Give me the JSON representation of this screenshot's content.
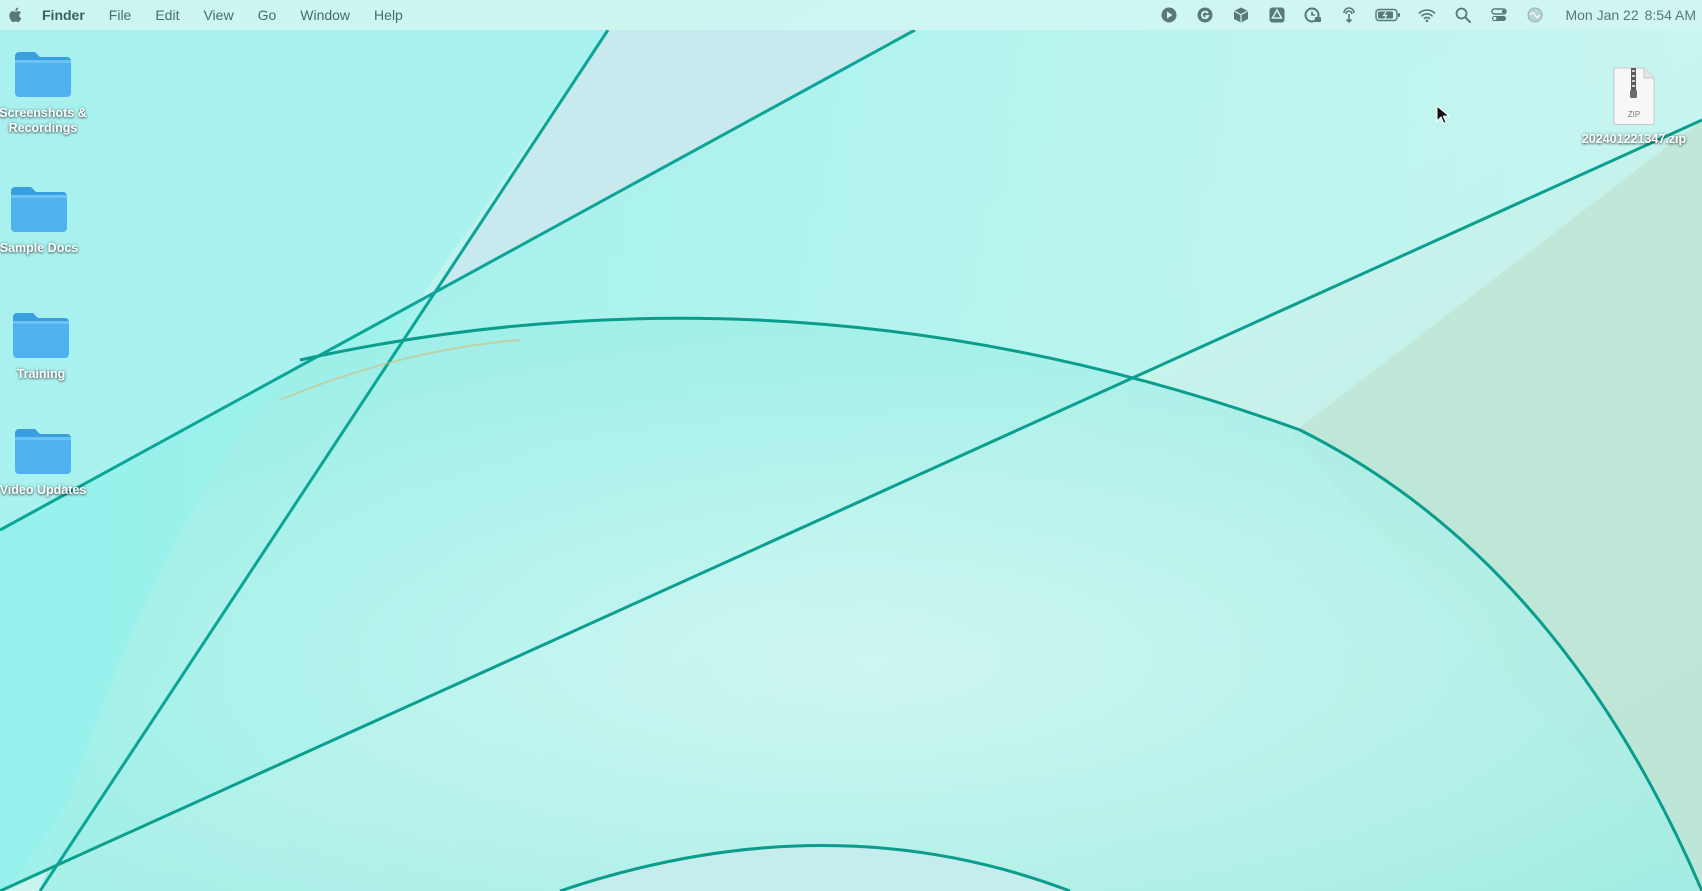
{
  "menubar": {
    "app_name": "Finder",
    "menus": [
      "File",
      "Edit",
      "View",
      "Go",
      "Window",
      "Help"
    ],
    "status_icons": [
      "play-circle-icon",
      "grammarly-icon",
      "package-box-icon",
      "google-drive-icon",
      "timer-lock-icon",
      "airdrop-icon",
      "battery-icon",
      "wifi-icon",
      "spotlight-search-icon",
      "control-center-icon",
      "siri-icon"
    ],
    "clock": {
      "date": "Mon Jan 22",
      "time": "8:54 AM"
    }
  },
  "desktop": {
    "left_icons": [
      {
        "label": "Screenshots & Recordings",
        "kind": "folder-icon"
      },
      {
        "label": "Sample Docs",
        "kind": "folder-icon"
      },
      {
        "label": "Training",
        "kind": "folder-icon"
      },
      {
        "label": "Video Updates",
        "kind": "folder-icon"
      }
    ],
    "right_icons": [
      {
        "label": "202401221347.zip",
        "kind": "zip-file-icon",
        "badge": "ZIP"
      }
    ]
  },
  "colors": {
    "wallpaper_base": "#bff0ec",
    "wallpaper_dark": "#0aa597",
    "folder_blue": "#4fb2ee",
    "folder_tab": "#3a9fe0"
  }
}
